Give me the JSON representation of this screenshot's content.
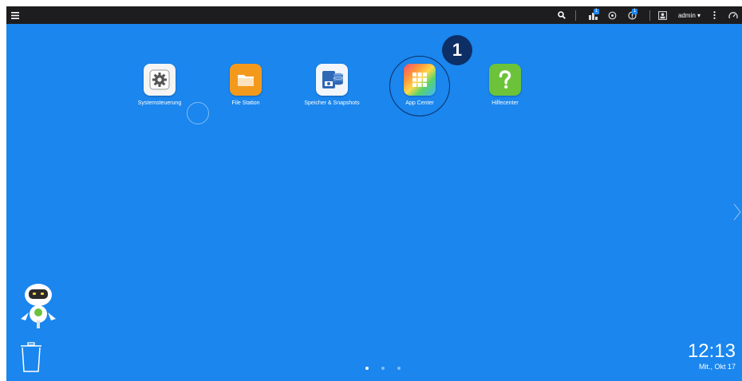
{
  "taskbar": {
    "user": "admin ▾",
    "notifications": {
      "tasks_badge": "1",
      "events_badge": "1"
    },
    "icons": [
      "menu-icon",
      "search-icon",
      "background-tasks-icon",
      "external-devices-icon",
      "event-notifications-icon",
      "user-icon",
      "more-icon",
      "dashboard-icon"
    ]
  },
  "desktop": {
    "apps": [
      {
        "label": "Systemsteuerung"
      },
      {
        "label": "File Station"
      },
      {
        "label": "Speicher & Snapshots"
      },
      {
        "label": "App Center"
      },
      {
        "label": "Hilfecenter"
      }
    ],
    "callout_number": "1",
    "page_indicator": {
      "pages": 3,
      "current": 1
    }
  },
  "clock": {
    "time": "12:13",
    "date": "Mit., Okt 17"
  },
  "colors": {
    "desktop": "#1a86ee",
    "taskbar": "#1d1d1f",
    "callout": "#0d2f66",
    "file_station": "#f39a1d",
    "help_center": "#6cc33a"
  }
}
